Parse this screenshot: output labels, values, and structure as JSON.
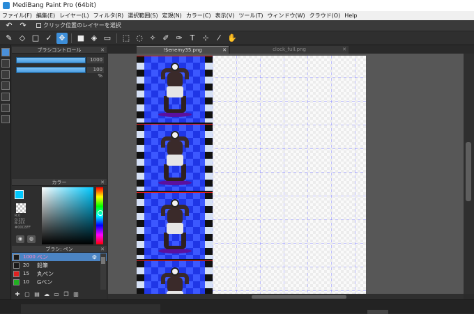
{
  "window": {
    "title": "MediBang Paint Pro (64bit)"
  },
  "menu": [
    "ファイル(F)",
    "編集(E)",
    "レイヤー(L)",
    "フィルタ(R)",
    "選択範囲(S)",
    "定規(N)",
    "カラー(C)",
    "表示(V)",
    "ツール(T)",
    "ウィンドウ(W)",
    "クラウド(O)",
    "Help"
  ],
  "undobar": {
    "checkbox_label": "クリック位置のレイヤーを選択"
  },
  "panels": {
    "brush_control": {
      "title": "ブラシコントロール",
      "size": "1000",
      "opacity": "100 %"
    },
    "color": {
      "title": "カラー",
      "r": "R:0",
      "g": "G:201",
      "b": "B:255",
      "hex": "#00C8FF",
      "fg_color": "#00c9ff"
    },
    "brush": {
      "title": "ブラシ: ペン",
      "items": [
        {
          "size": "1000",
          "name": "ペン",
          "color": "#1a1a1a"
        },
        {
          "size": "20",
          "name": "鉛筆",
          "color": "#1a1a1a"
        },
        {
          "size": "15",
          "name": "丸ペン",
          "color": "#e02020"
        },
        {
          "size": "10",
          "name": "Gペン",
          "color": "#20b020"
        }
      ]
    }
  },
  "tabs": [
    {
      "label": "!$enemy35.png"
    },
    {
      "label": "clock_full.png"
    }
  ],
  "icons": {
    "toolbar": [
      "brush-icon",
      "eraser-icon",
      "rectangle-outline-icon",
      "checkmark-icon",
      "move-icon",
      "filled-rect-icon",
      "bucket-fill-icon",
      "gradient-icon",
      "rect-select-icon",
      "lasso-select-icon",
      "magic-wand-icon",
      "select-pen-icon",
      "select-eraser-icon",
      "text-icon",
      "divide-panel-icon",
      "eyedropper-icon",
      "hand-icon"
    ]
  }
}
